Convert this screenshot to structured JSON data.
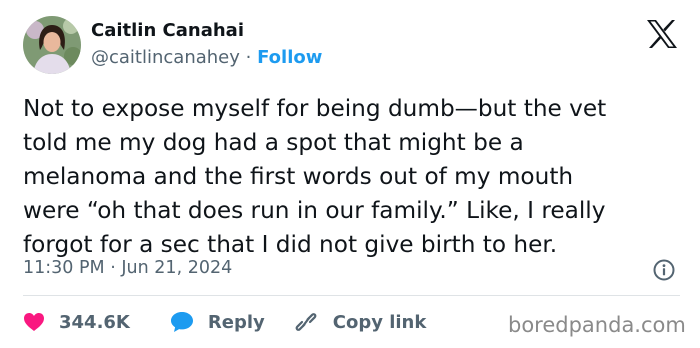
{
  "author": {
    "name": "Caitlin Canahai",
    "handle": "@caitlincanahey",
    "separator": "·",
    "follow_label": "Follow"
  },
  "tweet": {
    "lines": [
      "Not to expose myself for being dumb—but the vet",
      "told me my dog had a spot that might be a",
      "melanoma and the first words out of my mouth",
      "were “oh that does run in our family.” Like, I really",
      "forgot for a sec that I did not give birth to her."
    ],
    "time": "11:30 PM",
    "meta_separator": "·",
    "date": "Jun 21, 2024"
  },
  "actions": {
    "likes": "344.6K",
    "reply_label": "Reply",
    "copy_link_label": "Copy link"
  },
  "watermark": "boredpanda.com",
  "colors": {
    "text": "#0f1419",
    "secondary": "#536471",
    "link": "#1d9bf0",
    "like": "#f91880",
    "divider": "#dfe3e6"
  },
  "icons": [
    "x-logo-icon",
    "info-icon",
    "heart-icon",
    "reply-bubble-icon",
    "link-icon"
  ]
}
